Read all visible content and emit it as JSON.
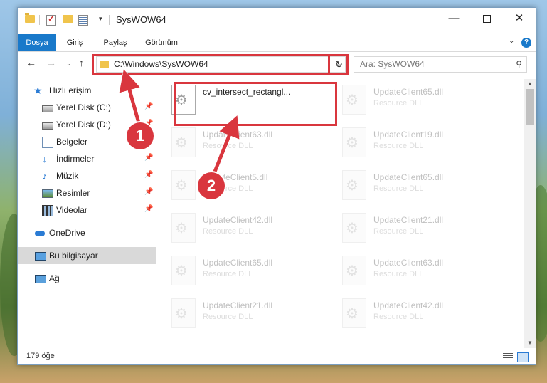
{
  "window": {
    "title": "SysWOW64",
    "minimize": "—",
    "close": "✕"
  },
  "ribbon": {
    "tabs": [
      {
        "label": "Dosya"
      },
      {
        "label": "Giriş"
      },
      {
        "label": "Paylaş"
      },
      {
        "label": "Görünüm"
      }
    ],
    "help": "?",
    "expand": "⌄"
  },
  "nav": {
    "back": "←",
    "forward": "→",
    "recent": "⌄",
    "up": "↑",
    "address": "C:\\Windows\\SysWOW64",
    "address_chevron": "⌄",
    "refresh": "↻",
    "search_placeholder": "Ara: SysWOW64",
    "search_icon": "⚲"
  },
  "sidebar": {
    "items": [
      {
        "label": "Hızlı erişim"
      },
      {
        "label": "Yerel Disk (C:)"
      },
      {
        "label": "Yerel Disk (D:)"
      },
      {
        "label": "Belgeler"
      },
      {
        "label": "İndirmeler"
      },
      {
        "label": "Müzik"
      },
      {
        "label": "Resimler"
      },
      {
        "label": "Videolar"
      },
      {
        "label": "OneDrive"
      },
      {
        "label": "Bu bilgisayar"
      },
      {
        "label": "Ağ"
      }
    ],
    "pin": "📌"
  },
  "files": [
    {
      "name": "cv_intersect_rectangl...",
      "type": ""
    },
    {
      "name": "UpdateClient65.dll",
      "type": "Resource DLL"
    },
    {
      "name": "UpdateClient63.dll",
      "type": "Resource DLL"
    },
    {
      "name": "UpdateClient19.dll",
      "type": "Resource DLL"
    },
    {
      "name": "UpdateClient5.dll",
      "type": "Resource DLL"
    },
    {
      "name": "UpdateClient65.dll",
      "type": "Resource DLL"
    },
    {
      "name": "UpdateClient42.dll",
      "type": "Resource DLL"
    },
    {
      "name": "UpdateClient21.dll",
      "type": "Resource DLL"
    },
    {
      "name": "UpdateClient65.dll",
      "type": "Resource DLL"
    },
    {
      "name": "UpdateClient63.dll",
      "type": "Resource DLL"
    },
    {
      "name": "UpdateClient21.dll",
      "type": "Resource DLL"
    },
    {
      "name": "UpdateClient42.dll",
      "type": "Resource DLL"
    }
  ],
  "status": {
    "count": "179 öğe"
  },
  "callouts": {
    "one": "1",
    "two": "2"
  },
  "colors": {
    "accent": "#1979ca",
    "highlight": "#d9363e"
  }
}
